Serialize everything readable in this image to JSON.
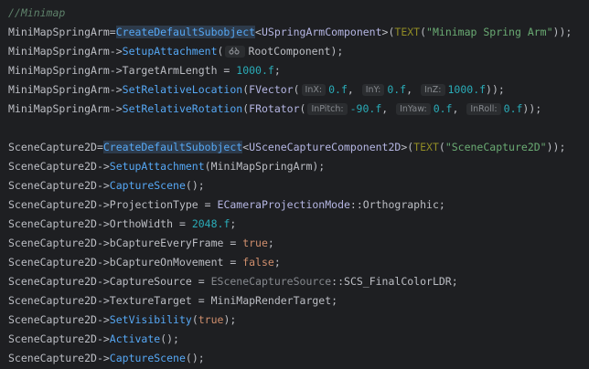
{
  "code": {
    "comment": "//Minimap",
    "spring": {
      "var": "MiniMapSpringArm",
      "create_fn": "CreateDefaultSubobject",
      "create_type": "USpringArmComponent",
      "text_macro": "TEXT",
      "create_name": "\"Minimap Spring Arm\"",
      "setup_fn": "SetupAttachment",
      "setup_arg": "RootComponent",
      "arm_prop": "TargetArmLength",
      "arm_val": "1000.f",
      "loc_fn": "SetRelativeLocation",
      "loc_type": "FVector",
      "hint_x": "InX:",
      "loc_x": "0.f",
      "hint_y": "InY:",
      "loc_y": "0.f",
      "hint_z": "InZ:",
      "loc_z": "1000.f",
      "rot_fn": "SetRelativeRotation",
      "rot_type": "FRotator",
      "hint_pitch": "InPitch:",
      "rot_pitch": "-90.f",
      "hint_yaw": "InYaw:",
      "rot_yaw": "0.f",
      "hint_roll": "InRoll:",
      "rot_roll": "0.f"
    },
    "capture": {
      "var": "SceneCapture2D",
      "create_fn": "CreateDefaultSubobject",
      "create_type": "USceneCaptureComponent2D",
      "text_macro": "TEXT",
      "create_name": "\"SceneCapture2D\"",
      "setup_fn": "SetupAttachment",
      "setup_arg": "MiniMapSpringArm",
      "capture_fn": "CaptureScene",
      "proj_prop": "ProjectionType",
      "proj_enum": "ECameraProjectionMode",
      "proj_val": "Orthographic",
      "ortho_prop": "OrthoWidth",
      "ortho_val": "2048.f",
      "every_prop": "bCaptureEveryFrame",
      "every_val": "true",
      "move_prop": "bCaptureOnMovement",
      "move_val": "false",
      "source_prop": "CaptureSource",
      "source_enum": "ESceneCaptureSource",
      "source_val": "SCS_FinalColorLDR",
      "target_prop": "TextureTarget",
      "target_val": "MiniMapRenderTarget",
      "vis_fn": "SetVisibility",
      "vis_val": "true",
      "activate_fn": "Activate",
      "capture_fn2": "CaptureScene"
    }
  },
  "colors": {
    "background": "#1e1f22",
    "comment": "#5f826b",
    "function": "#56a8f5",
    "type": "#b5b6e3",
    "string": "#6aab73",
    "number": "#2aacb8",
    "keyword": "#cf8e6d",
    "enum_member": "#c77dbb"
  }
}
